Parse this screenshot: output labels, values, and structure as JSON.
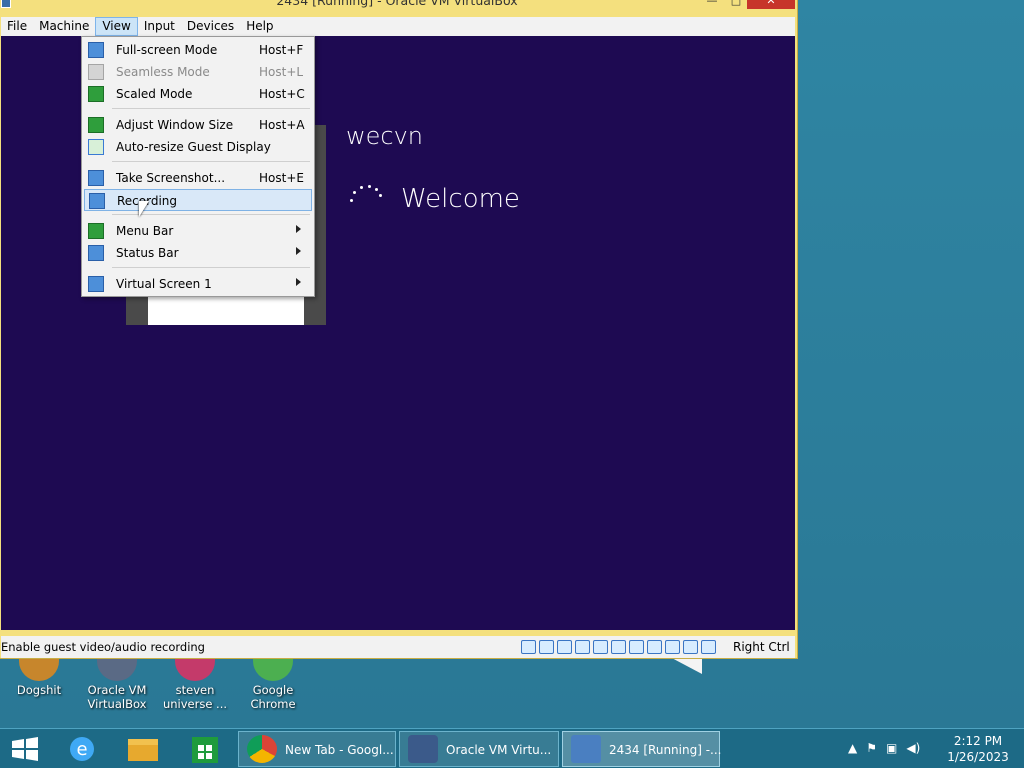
{
  "window": {
    "title": "2434 [Running] - Oracle VM VirtualBox",
    "close_glyph": "✕",
    "maximize_glyph": "□",
    "minimize_glyph": "—"
  },
  "menubar": {
    "items": [
      {
        "label": "File"
      },
      {
        "label": "Machine"
      },
      {
        "label": "View"
      },
      {
        "label": "Input"
      },
      {
        "label": "Devices"
      },
      {
        "label": "Help"
      }
    ]
  },
  "view_menu": {
    "items": [
      {
        "label": "Full-screen Mode",
        "shortcut": "Host+F"
      },
      {
        "label": "Seamless Mode",
        "shortcut": "Host+L"
      },
      {
        "label": "Scaled Mode",
        "shortcut": "Host+C"
      },
      {
        "label": "Adjust Window Size",
        "shortcut": "Host+A"
      },
      {
        "label": "Auto-resize Guest Display",
        "shortcut": ""
      },
      {
        "label": "Take Screenshot...",
        "shortcut": "Host+E"
      },
      {
        "label": "Recording",
        "shortcut": ""
      },
      {
        "label": "Menu Bar",
        "shortcut": ""
      },
      {
        "label": "Status Bar",
        "shortcut": ""
      },
      {
        "label": "Virtual Screen 1",
        "shortcut": ""
      }
    ]
  },
  "guest": {
    "user_name": "wecvn",
    "welcome": "Welcome"
  },
  "statusbar": {
    "text": "Enable guest video/audio recording",
    "host_key": "Right Ctrl"
  },
  "desktop_icons": [
    {
      "label": "Dogshit"
    },
    {
      "label": "Oracle VM VirtualBox"
    },
    {
      "label": "steven universe ..."
    },
    {
      "label": "Google Chrome"
    }
  ],
  "taskbar": {
    "tasks": [
      {
        "label": "New Tab - Googl..."
      },
      {
        "label": "Oracle VM Virtu..."
      },
      {
        "label": "2434 [Running] -..."
      }
    ],
    "time": "2:12 PM",
    "date": "1/26/2023"
  },
  "colors": {
    "guest_background": "#1e0a52",
    "window_frame": "#f4e07e",
    "taskbar": "#1d6a86"
  }
}
